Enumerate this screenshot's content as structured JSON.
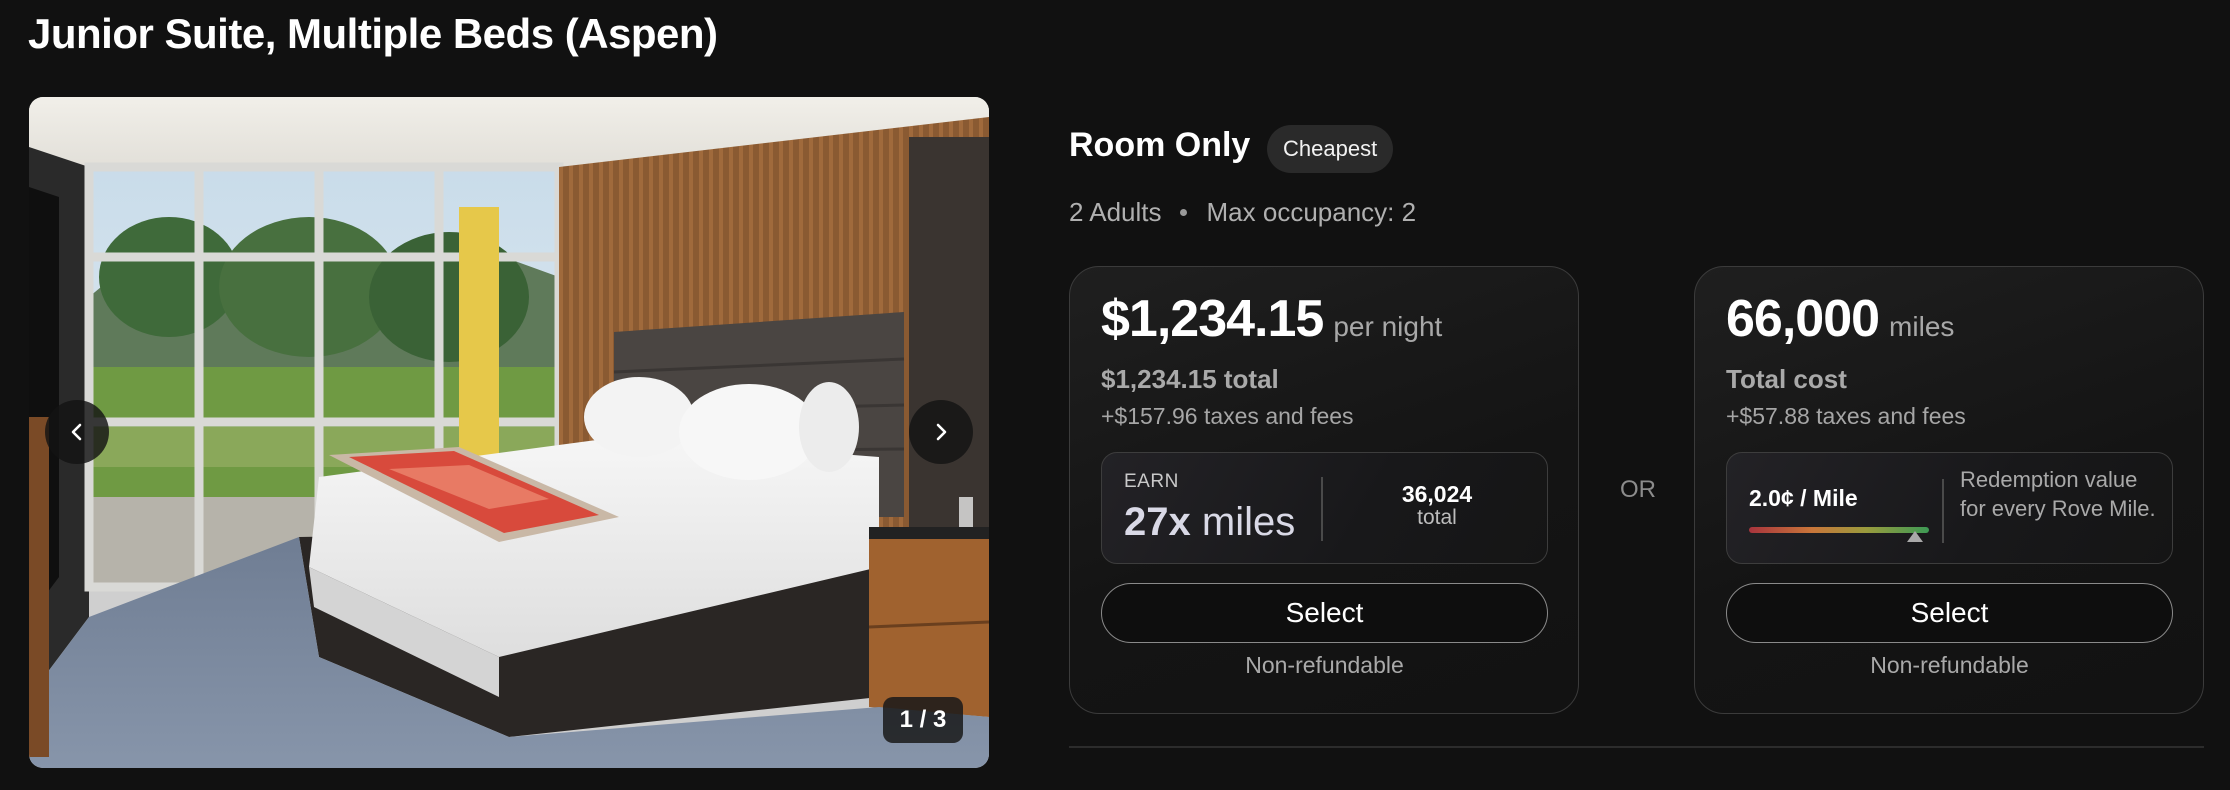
{
  "room": {
    "title": "Junior Suite, Multiple Beds (Aspen)"
  },
  "gallery": {
    "counter": "1 / 3",
    "current_index": 1,
    "total": 3
  },
  "rate": {
    "name": "Room Only",
    "badge": "Cheapest",
    "guests": "2 Adults",
    "max_occupancy": "Max occupancy: 2"
  },
  "cash_option": {
    "price": "$1,234.15",
    "price_unit": "per night",
    "total": "$1,234.15 total",
    "fees": "+$157.96 taxes and fees",
    "earn_label": "EARN",
    "earn_multiplier": "27x",
    "earn_unit": "miles",
    "bonus_value": "36,024",
    "bonus_label": "total",
    "select_label": "Select",
    "refund_policy": "Non-refundable"
  },
  "separator": "OR",
  "miles_option": {
    "price": "66,000",
    "price_unit": "miles",
    "total": "Total cost",
    "fees": "+$57.88 taxes and fees",
    "redemption_rate": "2.0¢ / Mile",
    "redemption_level": 0.92,
    "redemption_note": "Redemption value for every Rove Mile.",
    "select_label": "Select",
    "refund_policy": "Non-refundable"
  },
  "colors": {
    "background": "#111111",
    "card_border": "#3b3b3b",
    "text_primary": "#ffffff",
    "text_secondary": "#a9a9a9",
    "badge_bg": "#2a2a2a"
  },
  "icons": {
    "prev": "chevron-left-icon",
    "next": "chevron-right-icon",
    "marker": "triangle-up-icon"
  }
}
